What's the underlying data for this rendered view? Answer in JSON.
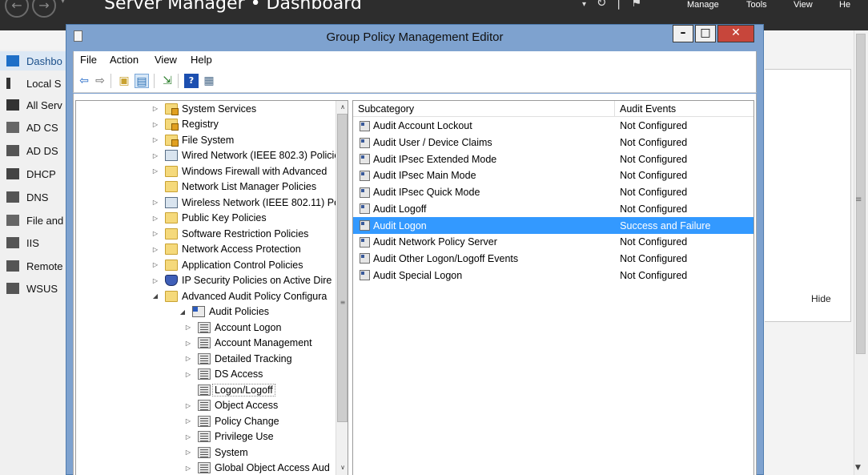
{
  "server_manager": {
    "title": "Server Manager • Dashboard",
    "menu": [
      "Manage",
      "Tools",
      "View",
      "He"
    ],
    "sidebar": [
      {
        "label": "Dashbo",
        "icon": "dashboard-icon",
        "active": true
      },
      {
        "label": "Local S",
        "icon": "server-icon",
        "active": false
      },
      {
        "label": "All Serv",
        "icon": "servers-icon",
        "active": false
      },
      {
        "label": "AD CS",
        "icon": "ad-cs-icon",
        "active": false
      },
      {
        "label": "AD DS",
        "icon": "ad-ds-icon",
        "active": false
      },
      {
        "label": "DHCP",
        "icon": "dhcp-icon",
        "active": false
      },
      {
        "label": "DNS",
        "icon": "dns-icon",
        "active": false
      },
      {
        "label": "File and",
        "icon": "file-services-icon",
        "active": false
      },
      {
        "label": "IIS",
        "icon": "iis-icon",
        "active": false
      },
      {
        "label": "Remote",
        "icon": "remote-icon",
        "active": false
      },
      {
        "label": "WSUS",
        "icon": "wsus-icon",
        "active": false
      }
    ],
    "hide_label": "Hide"
  },
  "gpme": {
    "title": "Group Policy Management Editor",
    "menu": [
      "File",
      "Action",
      "View",
      "Help"
    ],
    "tree": [
      {
        "label": "System Services",
        "expander": "▷",
        "icon": "folder-lock",
        "level": 0
      },
      {
        "label": "Registry",
        "expander": "▷",
        "icon": "folder-lock",
        "level": 0
      },
      {
        "label": "File System",
        "expander": "▷",
        "icon": "folder-lock",
        "level": 0
      },
      {
        "label": "Wired Network (IEEE 802.3) Policie",
        "expander": "▷",
        "icon": "net",
        "level": 0
      },
      {
        "label": "Windows Firewall with Advanced",
        "expander": "▷",
        "icon": "folder",
        "level": 0
      },
      {
        "label": "Network List Manager Policies",
        "expander": "",
        "icon": "folder",
        "level": 0
      },
      {
        "label": "Wireless Network (IEEE 802.11) Po",
        "expander": "▷",
        "icon": "net",
        "level": 0
      },
      {
        "label": "Public Key Policies",
        "expander": "▷",
        "icon": "folder",
        "level": 0
      },
      {
        "label": "Software Restriction Policies",
        "expander": "▷",
        "icon": "folder",
        "level": 0
      },
      {
        "label": "Network Access Protection",
        "expander": "▷",
        "icon": "folder",
        "level": 0
      },
      {
        "label": "Application Control Policies",
        "expander": "▷",
        "icon": "folder",
        "level": 0
      },
      {
        "label": "IP Security Policies on Active Dire",
        "expander": "▷",
        "icon": "shield",
        "level": 0
      },
      {
        "label": "Advanced Audit Policy Configura",
        "expander": "◢",
        "icon": "folder",
        "level": 0
      },
      {
        "label": "Audit Policies",
        "expander": "◢",
        "icon": "audit",
        "level": 1
      },
      {
        "label": "Account Logon",
        "expander": "▷",
        "icon": "doc",
        "level": 2
      },
      {
        "label": "Account Management",
        "expander": "▷",
        "icon": "doc",
        "level": 2
      },
      {
        "label": "Detailed Tracking",
        "expander": "▷",
        "icon": "doc",
        "level": 2
      },
      {
        "label": "DS Access",
        "expander": "▷",
        "icon": "doc",
        "level": 2
      },
      {
        "label": "Logon/Logoff",
        "expander": "",
        "icon": "doc",
        "level": 2,
        "selected": true
      },
      {
        "label": "Object Access",
        "expander": "▷",
        "icon": "doc",
        "level": 2
      },
      {
        "label": "Policy Change",
        "expander": "▷",
        "icon": "doc",
        "level": 2
      },
      {
        "label": "Privilege Use",
        "expander": "▷",
        "icon": "doc",
        "level": 2
      },
      {
        "label": "System",
        "expander": "▷",
        "icon": "doc",
        "level": 2
      },
      {
        "label": "Global Object Access Aud",
        "expander": "▷",
        "icon": "doc",
        "level": 2
      }
    ],
    "list": {
      "columns": [
        "Subcategory",
        "Audit Events"
      ],
      "rows": [
        {
          "subcategory": "Audit Account Lockout",
          "audit_events": "Not Configured"
        },
        {
          "subcategory": "Audit User / Device Claims",
          "audit_events": "Not Configured"
        },
        {
          "subcategory": "Audit IPsec Extended Mode",
          "audit_events": "Not Configured"
        },
        {
          "subcategory": "Audit IPsec Main Mode",
          "audit_events": "Not Configured"
        },
        {
          "subcategory": "Audit IPsec Quick Mode",
          "audit_events": "Not Configured"
        },
        {
          "subcategory": "Audit Logoff",
          "audit_events": "Not Configured"
        },
        {
          "subcategory": "Audit Logon",
          "audit_events": "Success and Failure",
          "selected": true
        },
        {
          "subcategory": "Audit Network Policy Server",
          "audit_events": "Not Configured"
        },
        {
          "subcategory": "Audit Other Logon/Logoff Events",
          "audit_events": "Not Configured"
        },
        {
          "subcategory": "Audit Special Logon",
          "audit_events": "Not Configured"
        }
      ]
    }
  },
  "colors": {
    "titlebar_blue": "#7ea2cf",
    "selection_blue": "#3399ff",
    "close_red": "#c7463b",
    "sm_dark": "#2d2d2d"
  }
}
